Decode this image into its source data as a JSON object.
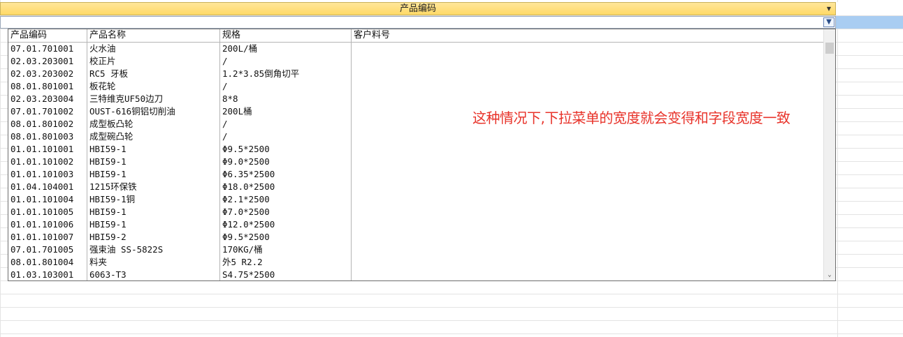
{
  "header": {
    "title": "产品编码",
    "dropdown_icon": "small-down-arrow"
  },
  "combo": {
    "value": "",
    "button_icon": "chevron-down-icon"
  },
  "dropdown": {
    "columns": [
      "产品编码",
      "产品名称",
      "规格",
      "客户料号"
    ],
    "rows": [
      [
        "07.01.701001",
        "火水油",
        "200L/桶",
        ""
      ],
      [
        "02.03.203001",
        "校正片",
        "/",
        ""
      ],
      [
        "02.03.203002",
        "RC5 牙板",
        "1.2*3.85倒角切平",
        ""
      ],
      [
        "08.01.801001",
        "板花轮",
        "/",
        ""
      ],
      [
        "02.03.203004",
        "三特维克UF50边刀",
        "8*8",
        ""
      ],
      [
        "07.01.701002",
        "OUST-616铜铝切削油",
        "200L桶",
        ""
      ],
      [
        "08.01.801002",
        "成型板凸轮",
        "/",
        ""
      ],
      [
        "08.01.801003",
        "成型碗凸轮",
        "/",
        ""
      ],
      [
        "01.01.101001",
        "HBI59-1",
        "Φ9.5*2500",
        ""
      ],
      [
        "01.01.101002",
        "HBI59-1",
        "Φ9.0*2500",
        ""
      ],
      [
        "01.01.101003",
        "HBI59-1",
        "Φ6.35*2500",
        ""
      ],
      [
        "01.04.104001",
        "1215环保铁",
        "Φ18.0*2500",
        ""
      ],
      [
        "01.01.101004",
        "HBI59-1铜",
        "Φ2.1*2500",
        ""
      ],
      [
        "01.01.101005",
        "HBI59-1",
        "Φ7.0*2500",
        ""
      ],
      [
        "01.01.101006",
        "HBI59-1",
        "Φ12.0*2500",
        ""
      ],
      [
        "01.01.101007",
        "HBI59-2",
        "Φ9.5*2500",
        ""
      ],
      [
        "07.01.701005",
        "强束油 SS-5822S",
        "170KG/桶",
        ""
      ],
      [
        "08.01.801004",
        "料夹",
        "外5 R2.2",
        ""
      ],
      [
        "01.03.103001",
        "6063-T3",
        "S4.75*2500",
        ""
      ]
    ],
    "scroll_down_icon": "chevron-down-icon"
  },
  "annotation": {
    "text": "这种情况下,下拉菜单的宽度就会变得和字段宽度一致",
    "color": "#e8332a"
  },
  "colors": {
    "header_bg": "#ffd966",
    "selection_strip": "#a9cdf2"
  }
}
